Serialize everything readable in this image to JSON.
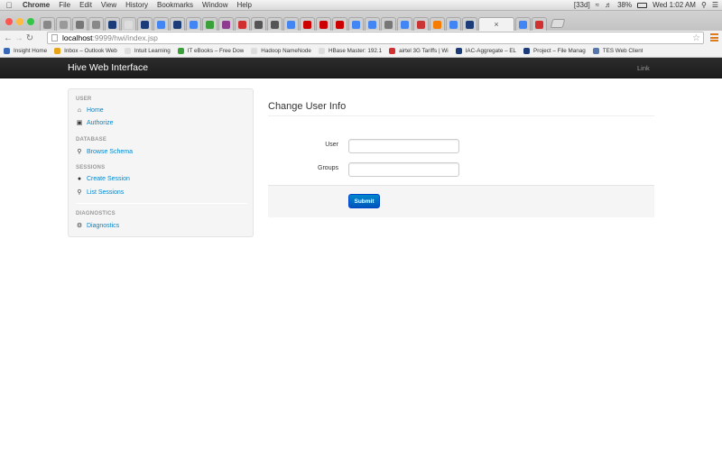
{
  "os_menubar": {
    "app_name": "Chrome",
    "menus": [
      "File",
      "Edit",
      "View",
      "History",
      "Bookmarks",
      "Window",
      "Help"
    ],
    "status": [
      "[33d]",
      "38%",
      "Wed 1:02 AM"
    ]
  },
  "browser": {
    "active_tab_close": "×",
    "url_host": "localhost",
    "url_path": ":9999/hwi/index.jsp",
    "bookmarks": [
      {
        "label": "Insight Home",
        "color": "#3a68b8"
      },
      {
        "label": "Inbox – Outlook Web",
        "color": "#e8a317"
      },
      {
        "label": "Intuit Learning",
        "color": "#dddddd"
      },
      {
        "label": "IT eBooks – Free Dow",
        "color": "#3aa03a"
      },
      {
        "label": "Hadoop NameNode",
        "color": "#dddddd"
      },
      {
        "label": "HBase Master: 192.1",
        "color": "#dddddd"
      },
      {
        "label": "airtel 3G Tariffs | Wi",
        "color": "#d03030"
      },
      {
        "label": "IAC-Aggregate – EL",
        "color": "#1b3c78"
      },
      {
        "label": "Project – File Manag",
        "color": "#1b3c78"
      },
      {
        "label": "TES Web Client",
        "color": "#5577aa"
      }
    ]
  },
  "app": {
    "brand": "Hive Web Interface",
    "nav_link": "Link"
  },
  "sidebar": {
    "sections": [
      {
        "header": "USER",
        "items": [
          {
            "label": "Home",
            "icon": "home-icon"
          },
          {
            "label": "Authorize",
            "icon": "lock-icon"
          }
        ]
      },
      {
        "header": "DATABASE",
        "items": [
          {
            "label": "Browse Schema",
            "icon": "search-icon"
          }
        ]
      },
      {
        "header": "SESSIONS",
        "items": [
          {
            "label": "Create Session",
            "icon": "user-icon"
          },
          {
            "label": "List Sessions",
            "icon": "search-icon"
          }
        ]
      },
      {
        "header": "DIAGNOSTICS",
        "items": [
          {
            "label": "Diagnostics",
            "icon": "gear-icon"
          }
        ]
      }
    ]
  },
  "form": {
    "title": "Change User Info",
    "user_label": "User",
    "user_value": "",
    "groups_label": "Groups",
    "groups_value": "",
    "submit_label": "Submit"
  },
  "colors": {
    "navbar": "#1f1f1f",
    "link": "#0088cc",
    "submit": "#0066cc"
  }
}
